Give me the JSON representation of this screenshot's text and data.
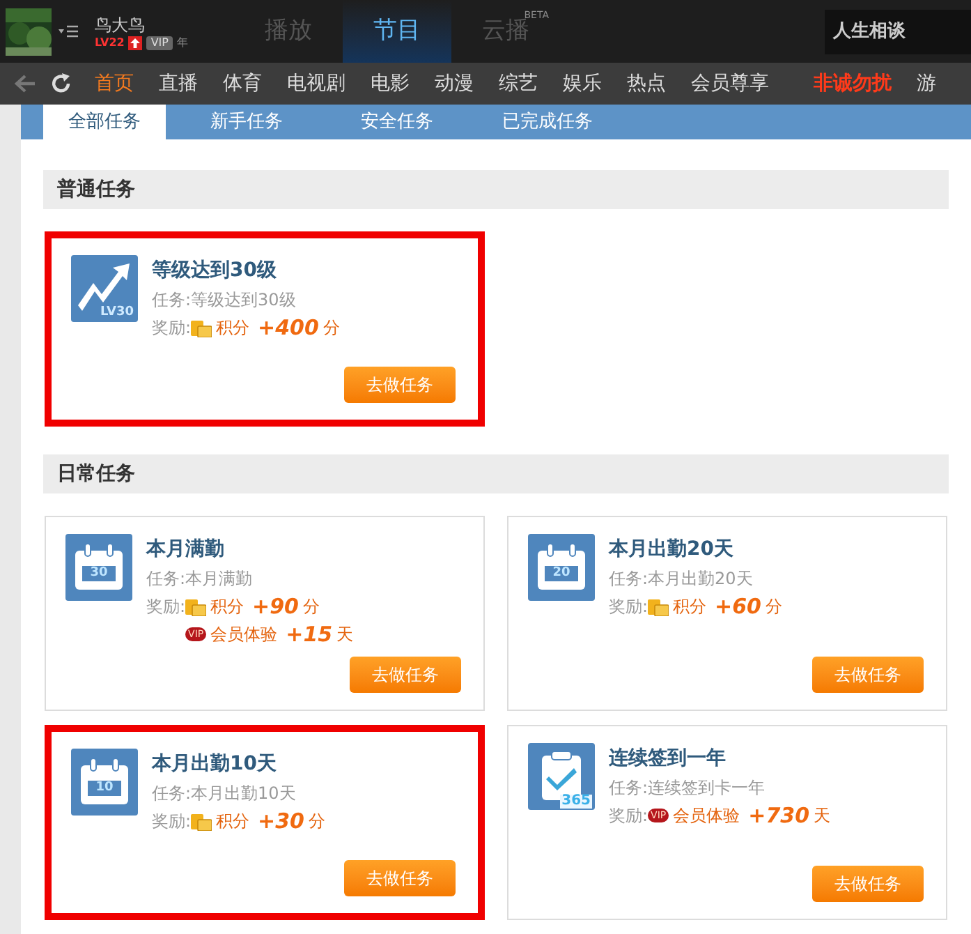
{
  "top_bar": {
    "user": {
      "name": "鸟大鸟",
      "level": "LV22",
      "vip": "VIP",
      "vip_term": "年"
    },
    "tabs": [
      {
        "label": "播放",
        "selected": false
      },
      {
        "label": "节目",
        "selected": true
      },
      {
        "label": "云播",
        "selected": false,
        "sup": "BETA"
      }
    ],
    "search": {
      "value": "人生相谈"
    }
  },
  "nav": {
    "items": [
      {
        "label": "首页",
        "selected": true,
        "kind": "normal"
      },
      {
        "label": "直播",
        "selected": false,
        "kind": "normal"
      },
      {
        "label": "体育",
        "selected": false,
        "kind": "normal"
      },
      {
        "label": "电视剧",
        "selected": false,
        "kind": "normal"
      },
      {
        "label": "电影",
        "selected": false,
        "kind": "normal"
      },
      {
        "label": "动漫",
        "selected": false,
        "kind": "normal"
      },
      {
        "label": "综艺",
        "selected": false,
        "kind": "normal"
      },
      {
        "label": "娱乐",
        "selected": false,
        "kind": "normal"
      },
      {
        "label": "热点",
        "selected": false,
        "kind": "normal"
      },
      {
        "label": "会员尊享",
        "selected": false,
        "kind": "normal"
      },
      {
        "label": "非诚勿扰",
        "selected": false,
        "kind": "hot"
      },
      {
        "label": "游",
        "selected": false,
        "kind": "normal"
      }
    ]
  },
  "task_tabs": [
    {
      "label": "全部任务",
      "selected": true
    },
    {
      "label": "新手任务",
      "selected": false
    },
    {
      "label": "安全任务",
      "selected": false
    },
    {
      "label": "已完成任务",
      "selected": false
    }
  ],
  "sections": [
    {
      "title": "普通任务",
      "cards": [
        {
          "title": "等级达到30级",
          "task_label": "任务:",
          "task": "等级达到30级",
          "kind": "chart",
          "icon_label": "LV30",
          "highlighted": true,
          "reward_label": "奖励:",
          "rewards": [
            {
              "kind": "points",
              "name": "积分",
              "amount": "+400",
              "unit": "分"
            }
          ],
          "button": "去做任务"
        }
      ]
    },
    {
      "title": "日常任务",
      "cards": [
        {
          "title": "本月满勤",
          "task_label": "任务:",
          "task": "本月满勤",
          "kind": "calendar",
          "icon_label": "30",
          "highlighted": false,
          "reward_label": "奖励:",
          "rewards": [
            {
              "kind": "points",
              "name": "积分",
              "amount": "+90",
              "unit": "分"
            },
            {
              "kind": "vip",
              "tag": "VIP",
              "name": "会员体验",
              "amount": "+15",
              "unit": "天"
            }
          ],
          "button": "去做任务"
        },
        {
          "title": "本月出勤20天",
          "task_label": "任务:",
          "task": "本月出勤20天",
          "kind": "calendar",
          "icon_label": "20",
          "highlighted": false,
          "reward_label": "奖励:",
          "rewards": [
            {
              "kind": "points",
              "name": "积分",
              "amount": "+60",
              "unit": "分"
            }
          ],
          "button": "去做任务"
        },
        {
          "title": "本月出勤10天",
          "task_label": "任务:",
          "task": "本月出勤10天",
          "kind": "calendar",
          "icon_label": "10",
          "highlighted": true,
          "reward_label": "奖励:",
          "rewards": [
            {
              "kind": "points",
              "name": "积分",
              "amount": "+30",
              "unit": "分"
            }
          ],
          "button": "去做任务"
        },
        {
          "title": "连续签到一年",
          "task_label": "任务:",
          "task": "连续签到卡一年",
          "kind": "clipboard",
          "icon_label": "365",
          "highlighted": false,
          "reward_label": "奖励:",
          "rewards": [
            {
              "kind": "vip",
              "tag": "VIP",
              "name": "会员体验",
              "amount": "+730",
              "unit": "天"
            }
          ],
          "button": "去做任务"
        }
      ]
    }
  ]
}
